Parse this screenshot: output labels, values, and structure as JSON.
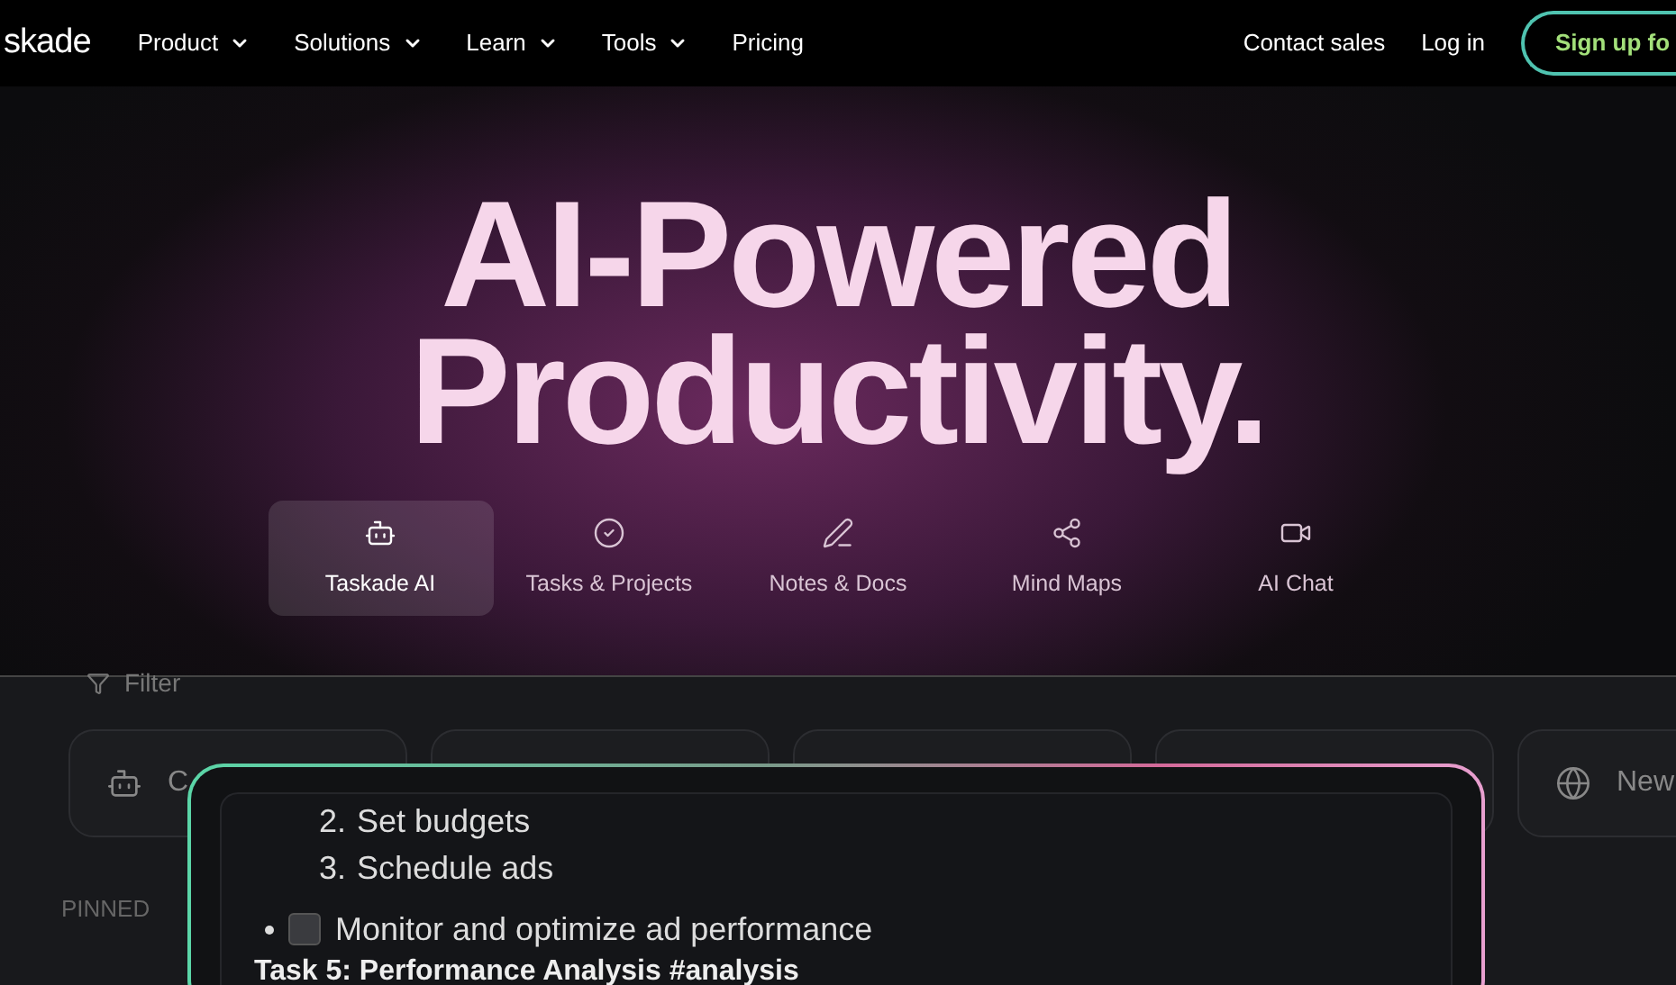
{
  "nav": {
    "logo": "skade",
    "items": [
      {
        "label": "Product",
        "dropdown": true
      },
      {
        "label": "Solutions",
        "dropdown": true
      },
      {
        "label": "Learn",
        "dropdown": true
      },
      {
        "label": "Tools",
        "dropdown": true
      },
      {
        "label": "Pricing",
        "dropdown": false
      }
    ],
    "contact": "Contact sales",
    "login": "Log in",
    "signup": "Sign up fo"
  },
  "hero": {
    "title_lines": [
      "AI-Powered",
      "Productivity."
    ],
    "tabs": [
      {
        "label": "Taskade AI",
        "selected": true
      },
      {
        "label": "Tasks & Projects",
        "selected": false
      },
      {
        "label": "Notes & Docs",
        "selected": false
      },
      {
        "label": "Mind Maps",
        "selected": false
      },
      {
        "label": "AI Chat",
        "selected": false
      }
    ]
  },
  "app": {
    "filter": "Filter",
    "cards": [
      {
        "kind": "labeled",
        "label": "C"
      },
      {
        "kind": "blank"
      },
      {
        "kind": "blank"
      },
      {
        "kind": "blank"
      },
      {
        "kind": "labeled",
        "label": "New"
      }
    ],
    "pinned": "PINNED"
  },
  "editor": {
    "list": [
      {
        "number": "2.",
        "text": "Set budgets"
      },
      {
        "number": "3.",
        "text": "Schedule ads"
      }
    ],
    "task": {
      "text": "Monitor and optimize ad performance",
      "checked": false
    },
    "heading": "Task 5: Performance Analysis #analysis"
  }
}
